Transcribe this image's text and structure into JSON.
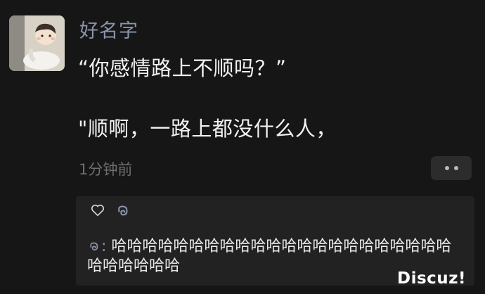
{
  "post": {
    "author": "好名字",
    "text_line1": "“你感情路上不顺吗？”",
    "text_line2": "\"顺啊，一路上都没什么人，",
    "time": "1分钟前"
  },
  "interactions": {
    "comment_prefix": ":",
    "comment_text": "哈哈哈哈哈哈哈哈哈哈哈哈哈哈哈哈哈哈哈哈哈哈哈哈哈哈哈哈"
  },
  "watermark": "Discuz!",
  "icons": {
    "like": "heart-icon",
    "liker": "wechat-liker-icon",
    "more": "more-dots-icon"
  },
  "colors": {
    "background": "#161616",
    "name_blue": "#8c95ad",
    "panel": "#222222"
  }
}
